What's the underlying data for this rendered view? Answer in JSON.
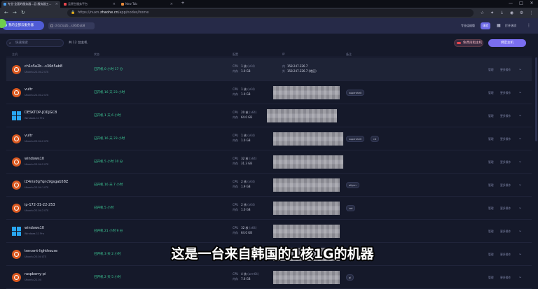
{
  "browser": {
    "tabs": [
      {
        "label": "专业·全面的服务器…云·服务器工…",
        "favicon_color": "#4a9be8",
        "active": true
      },
      {
        "label": "云原生服务平台",
        "favicon_color": "#e8474e",
        "active": false
      },
      {
        "label": "New Tab",
        "favicon_color": "#e88a3a",
        "active": false
      }
    ],
    "new_tab": "+",
    "window_controls": {
      "minimize": "—",
      "maximize": "□",
      "close": "✕"
    },
    "nav": {
      "back": "←",
      "forward": "→",
      "reload": "↻"
    },
    "url": {
      "prefix": "https://nuxn.",
      "host": "zhaohe.cn",
      "path": "/app/nodes/home"
    }
  },
  "app": {
    "brand_button": "我的全部云服务器",
    "page_tab": "ch1s5a2b…s36d5ab8",
    "header_buttons": [
      "专业运维版",
      "体验",
      "打开选项"
    ],
    "search_placeholder": "快速搜索",
    "host_count": "共 12 台主机",
    "free_button": "免费再租主机",
    "bind_button": "绑定主机",
    "columns": [
      "主机",
      "状态",
      "配置",
      "IP",
      "备注"
    ],
    "actions": {
      "manage": "管理",
      "more": "更多操作"
    },
    "spec_keys": {
      "cpu": "CPU",
      "mem": "内存"
    },
    "ip_keys": {
      "inner": "内",
      "outer": "外"
    }
  },
  "hosts": [
    {
      "name": "ch1s5a2b…s36d5ab8",
      "os_label": "Ubuntu 22.04.2 LTS",
      "os": "ubuntu",
      "status": "已开机 0 小时 17 分",
      "cpu": "1 核",
      "arch": "(x64)",
      "mem": "1.0 GB",
      "ip_inner": "158.247.226.7",
      "ip_outer": "158.247.226.7",
      "ip_note": "(地区)",
      "tags": []
    },
    {
      "name": "vultr",
      "os_label": "Ubuntu 22.04.2 LTS",
      "os": "ubuntu",
      "status": "已开机 16 天 23 小时",
      "cpu": "1 核",
      "arch": "(x64)",
      "mem": "1.0 GB",
      "tags": [
        "supershell"
      ]
    },
    {
      "name": "DESKTOP-JODJGC8",
      "os_label": "Windows 11 Pro",
      "os": "windows",
      "status": "已开机 1 天 6 小时",
      "cpu": "20 核",
      "arch": "(x64)",
      "mem": "64.0 GB",
      "tags": []
    },
    {
      "name": "vultr",
      "os_label": "Ubuntu 22.04.2 LTS",
      "os": "ubuntu",
      "status": "已开机 16 天 23 小时",
      "cpu": "1 核",
      "arch": "(x64)",
      "mem": "1.0 GB",
      "tags": [
        "supershell",
        "cd"
      ]
    },
    {
      "name": "windows10",
      "os_label": "Ubuntu 22.04.2 LTS",
      "os": "ubuntu",
      "status": "已开机 5 小时 10 分",
      "cpu": "32 核",
      "arch": "(x64)",
      "mem": "31.3 GB",
      "tags": []
    },
    {
      "name": "iZ4nix0g7qnc9gsgab58Z",
      "os_label": "Ubuntu 22.04.1 LTS",
      "os": "ubuntu",
      "status": "已开机 16 天 7 小时",
      "cpu": "2 核",
      "arch": "(x64)",
      "mem": "1.9 GB",
      "tags": [
        "aliyun"
      ]
    },
    {
      "name": "ip-172-31-22-253",
      "os_label": "Ubuntu 22.04.2 LTS",
      "os": "ubuntu",
      "status": "已开机 5 小时",
      "cpu": "2 核",
      "arch": "(x64)",
      "mem": "1.0 GB",
      "tags": [
        "cat"
      ]
    },
    {
      "name": "windows10",
      "os_label": "Windows 11 Pro",
      "os": "windows",
      "status": "已开机 21 小时 9 分",
      "cpu": "32 核",
      "arch": "(x64)",
      "mem": "64.0 GB",
      "tags": []
    },
    {
      "name": "tencent-lighthouse",
      "os_label": "Ubuntu 20.04 LTS",
      "os": "ubuntu",
      "status": "已开机 3 天 2 小时",
      "cpu": "2 核",
      "arch": "(x64)",
      "mem": "1.9 GB",
      "tags": []
    },
    {
      "name": "raspberry-pi",
      "os_label": "Ubuntu 22.04",
      "os": "ubuntu",
      "status": "已开机 2 天 5 小时",
      "cpu": "4 核",
      "arch": "(arm64)",
      "mem": "7.6 GB",
      "tags": [
        "pi"
      ]
    }
  ],
  "subtitle": "这是一台来自韩国的1核1G的机器"
}
